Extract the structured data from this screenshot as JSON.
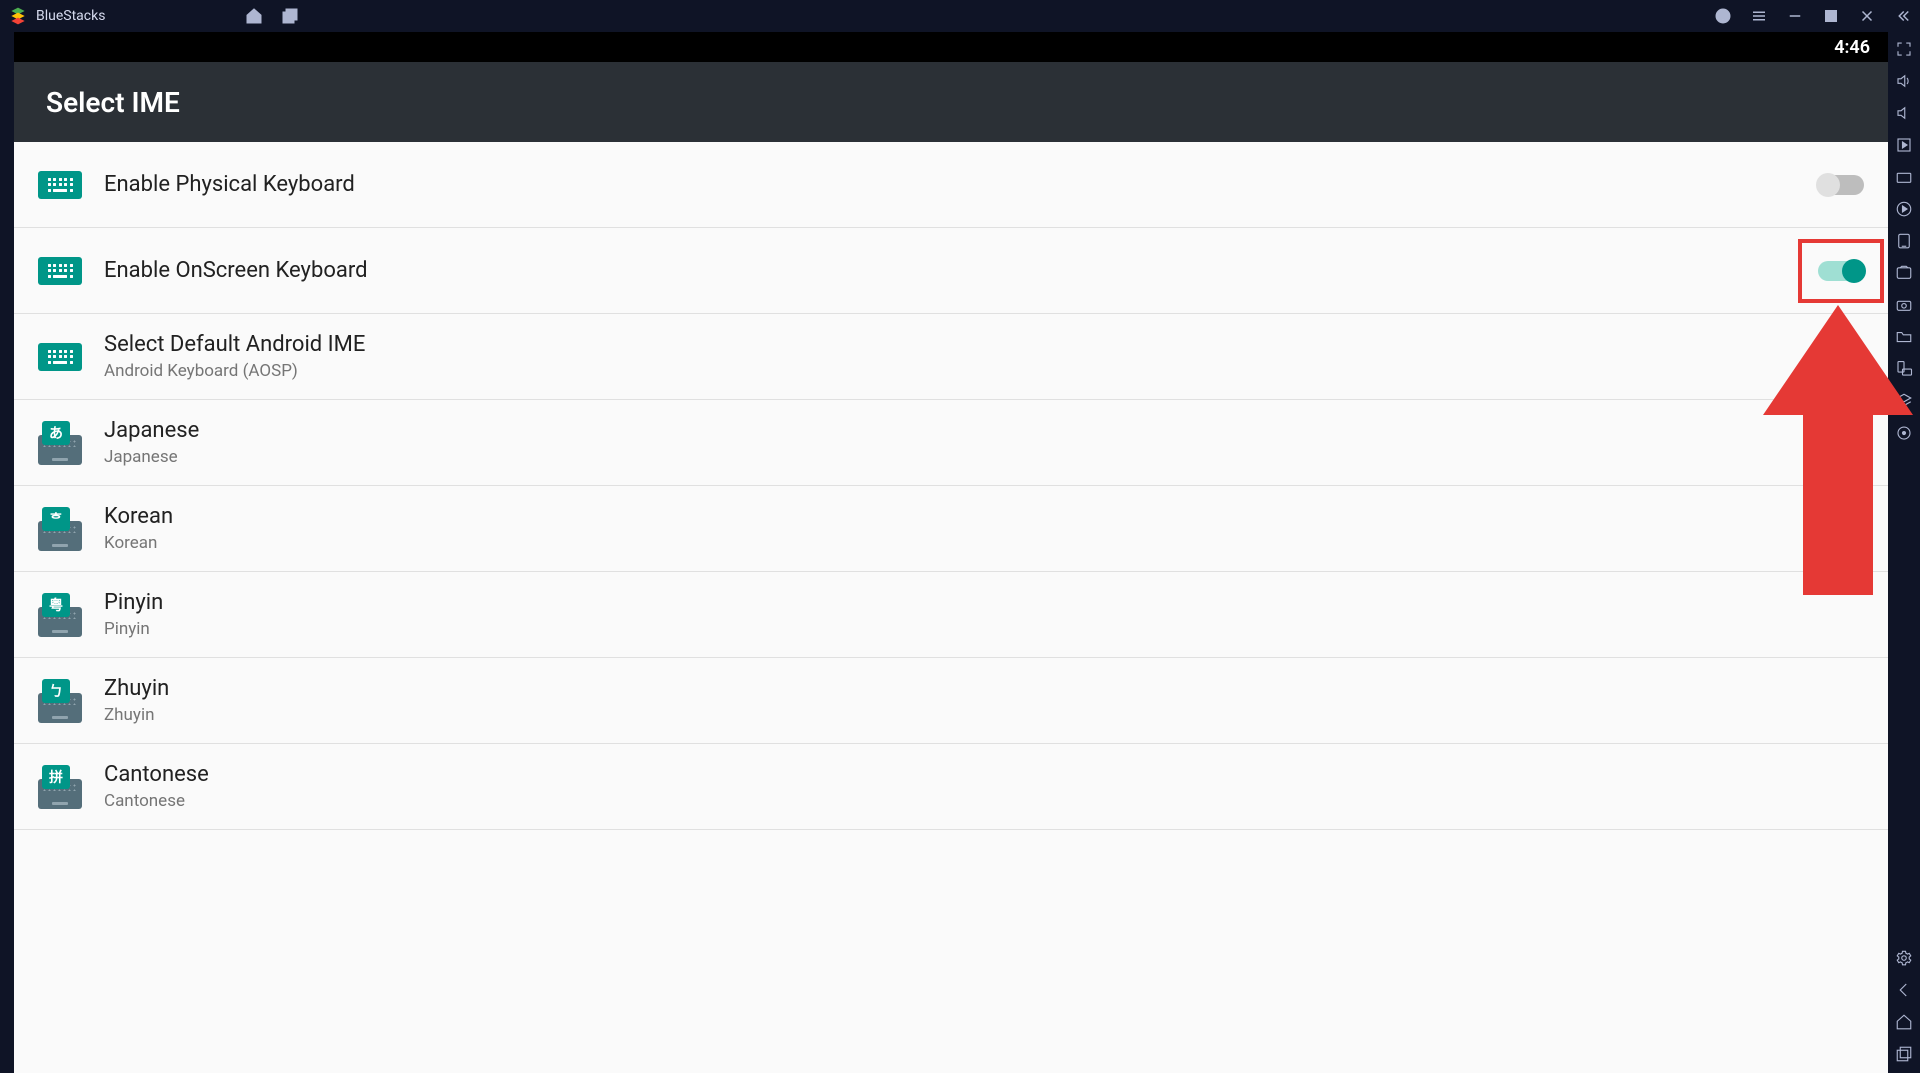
{
  "app": {
    "name": "BlueStacks"
  },
  "status": {
    "time": "4:46"
  },
  "page": {
    "title": "Select IME"
  },
  "settings": [
    {
      "id": "physical",
      "kind": "toggle-kb",
      "title": "Enable Physical Keyboard",
      "toggle": "off"
    },
    {
      "id": "onscreen",
      "kind": "toggle-kb",
      "title": "Enable OnScreen Keyboard",
      "toggle": "on",
      "highlight": true
    },
    {
      "id": "default",
      "kind": "kb",
      "title": "Select Default Android IME",
      "sub": "Android Keyboard (AOSP)"
    },
    {
      "id": "japanese",
      "kind": "lang",
      "glyph": "あ",
      "title": "Japanese",
      "sub": "Japanese"
    },
    {
      "id": "korean",
      "kind": "lang",
      "glyph": "ᄒ",
      "title": "Korean",
      "sub": "Korean"
    },
    {
      "id": "pinyin",
      "kind": "lang",
      "glyph": "粤",
      "title": "Pinyin",
      "sub": "Pinyin"
    },
    {
      "id": "zhuyin",
      "kind": "lang",
      "glyph": "ㄅ",
      "title": "Zhuyin",
      "sub": "Zhuyin"
    },
    {
      "id": "cantonese",
      "kind": "lang",
      "glyph": "拼",
      "title": "Cantonese",
      "sub": "Cantonese"
    }
  ]
}
